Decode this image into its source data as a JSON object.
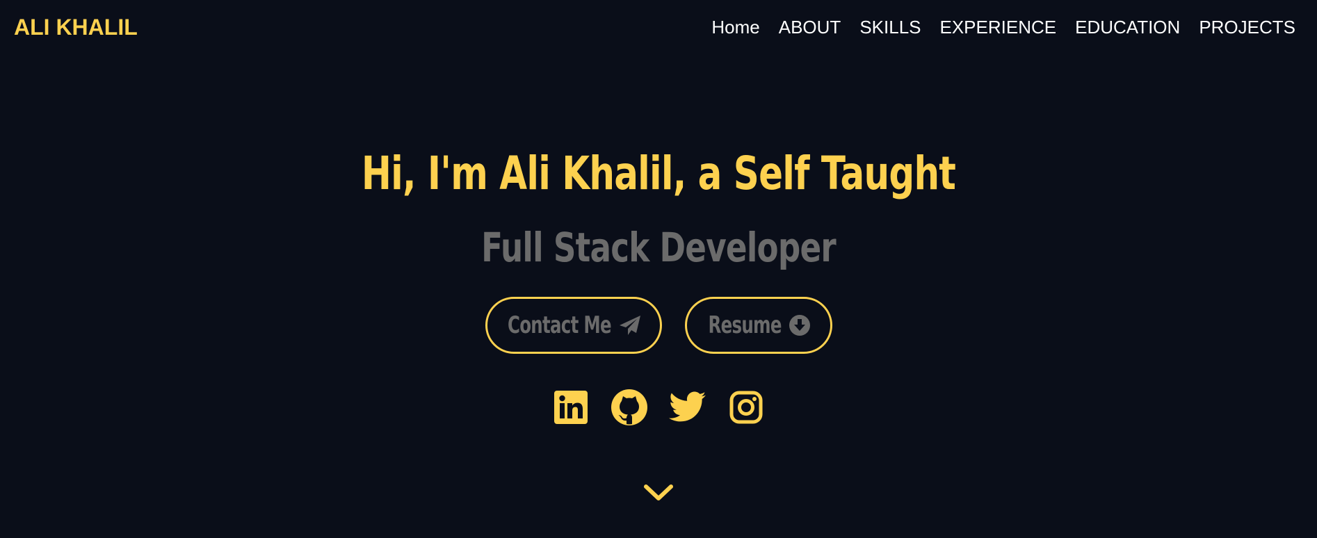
{
  "header": {
    "logo": "ALI KHALIL",
    "nav": [
      {
        "label": "Home"
      },
      {
        "label": "ABOUT"
      },
      {
        "label": "SKILLS"
      },
      {
        "label": "EXPERIENCE"
      },
      {
        "label": "EDUCATION"
      },
      {
        "label": "PROJECTS"
      }
    ]
  },
  "hero": {
    "title": "Hi, I'm Ali Khalil, a Self Taught",
    "subtitle": "Full Stack Developer",
    "buttons": {
      "contact_label": "Contact Me",
      "contact_icon": "paper-plane-icon",
      "resume_label": "Resume",
      "resume_icon": "download-circle-icon"
    },
    "socials": [
      {
        "icon": "linkedin-icon"
      },
      {
        "icon": "github-icon"
      },
      {
        "icon": "twitter-icon"
      },
      {
        "icon": "instagram-icon"
      }
    ],
    "scroll_icon": "chevron-down-icon"
  },
  "colors": {
    "background": "#0a0e19",
    "accent": "#fdd14f",
    "muted": "#6b6b6b",
    "nav_text": "#ffffff"
  }
}
